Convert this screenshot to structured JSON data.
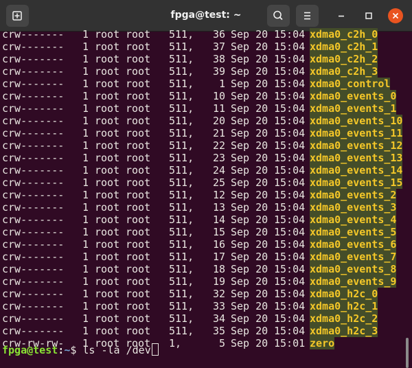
{
  "window": {
    "title": "fpga@test: ~",
    "icons": {
      "new_tab": "new-tab-icon",
      "search": "search-icon",
      "menu": "hamburger-menu-icon",
      "minimize": "minimize-icon",
      "maximize": "maximize-icon",
      "close": "close-icon"
    },
    "colors": {
      "background": "#300a24",
      "titlebar": "#323232",
      "close_button": "#e95420",
      "device_name_fg": "#f4c728",
      "device_name_bg": "#444d29",
      "prompt_user": "#8ae234",
      "prompt_path": "#729fcf"
    }
  },
  "terminal": {
    "listing": [
      {
        "perm": "crw-------",
        "links": "1",
        "owner": "root",
        "group": "root",
        "major": "511,",
        "minor": "36",
        "date": "Sep 20",
        "time": "15:04",
        "name": "xdma0_c2h_0"
      },
      {
        "perm": "crw-------",
        "links": "1",
        "owner": "root",
        "group": "root",
        "major": "511,",
        "minor": "37",
        "date": "Sep 20",
        "time": "15:04",
        "name": "xdma0_c2h_1"
      },
      {
        "perm": "crw-------",
        "links": "1",
        "owner": "root",
        "group": "root",
        "major": "511,",
        "minor": "38",
        "date": "Sep 20",
        "time": "15:04",
        "name": "xdma0_c2h_2"
      },
      {
        "perm": "crw-------",
        "links": "1",
        "owner": "root",
        "group": "root",
        "major": "511,",
        "minor": "39",
        "date": "Sep 20",
        "time": "15:04",
        "name": "xdma0_c2h_3"
      },
      {
        "perm": "crw-------",
        "links": "1",
        "owner": "root",
        "group": "root",
        "major": "511,",
        "minor": "1",
        "date": "Sep 20",
        "time": "15:04",
        "name": "xdma0_control"
      },
      {
        "perm": "crw-------",
        "links": "1",
        "owner": "root",
        "group": "root",
        "major": "511,",
        "minor": "10",
        "date": "Sep 20",
        "time": "15:04",
        "name": "xdma0_events_0"
      },
      {
        "perm": "crw-------",
        "links": "1",
        "owner": "root",
        "group": "root",
        "major": "511,",
        "minor": "11",
        "date": "Sep 20",
        "time": "15:04",
        "name": "xdma0_events_1"
      },
      {
        "perm": "crw-------",
        "links": "1",
        "owner": "root",
        "group": "root",
        "major": "511,",
        "minor": "20",
        "date": "Sep 20",
        "time": "15:04",
        "name": "xdma0_events_10"
      },
      {
        "perm": "crw-------",
        "links": "1",
        "owner": "root",
        "group": "root",
        "major": "511,",
        "minor": "21",
        "date": "Sep 20",
        "time": "15:04",
        "name": "xdma0_events_11"
      },
      {
        "perm": "crw-------",
        "links": "1",
        "owner": "root",
        "group": "root",
        "major": "511,",
        "minor": "22",
        "date": "Sep 20",
        "time": "15:04",
        "name": "xdma0_events_12"
      },
      {
        "perm": "crw-------",
        "links": "1",
        "owner": "root",
        "group": "root",
        "major": "511,",
        "minor": "23",
        "date": "Sep 20",
        "time": "15:04",
        "name": "xdma0_events_13"
      },
      {
        "perm": "crw-------",
        "links": "1",
        "owner": "root",
        "group": "root",
        "major": "511,",
        "minor": "24",
        "date": "Sep 20",
        "time": "15:04",
        "name": "xdma0_events_14"
      },
      {
        "perm": "crw-------",
        "links": "1",
        "owner": "root",
        "group": "root",
        "major": "511,",
        "minor": "25",
        "date": "Sep 20",
        "time": "15:04",
        "name": "xdma0_events_15"
      },
      {
        "perm": "crw-------",
        "links": "1",
        "owner": "root",
        "group": "root",
        "major": "511,",
        "minor": "12",
        "date": "Sep 20",
        "time": "15:04",
        "name": "xdma0_events_2"
      },
      {
        "perm": "crw-------",
        "links": "1",
        "owner": "root",
        "group": "root",
        "major": "511,",
        "minor": "13",
        "date": "Sep 20",
        "time": "15:04",
        "name": "xdma0_events_3"
      },
      {
        "perm": "crw-------",
        "links": "1",
        "owner": "root",
        "group": "root",
        "major": "511,",
        "minor": "14",
        "date": "Sep 20",
        "time": "15:04",
        "name": "xdma0_events_4"
      },
      {
        "perm": "crw-------",
        "links": "1",
        "owner": "root",
        "group": "root",
        "major": "511,",
        "minor": "15",
        "date": "Sep 20",
        "time": "15:04",
        "name": "xdma0_events_5"
      },
      {
        "perm": "crw-------",
        "links": "1",
        "owner": "root",
        "group": "root",
        "major": "511,",
        "minor": "16",
        "date": "Sep 20",
        "time": "15:04",
        "name": "xdma0_events_6"
      },
      {
        "perm": "crw-------",
        "links": "1",
        "owner": "root",
        "group": "root",
        "major": "511,",
        "minor": "17",
        "date": "Sep 20",
        "time": "15:04",
        "name": "xdma0_events_7"
      },
      {
        "perm": "crw-------",
        "links": "1",
        "owner": "root",
        "group": "root",
        "major": "511,",
        "minor": "18",
        "date": "Sep 20",
        "time": "15:04",
        "name": "xdma0_events_8"
      },
      {
        "perm": "crw-------",
        "links": "1",
        "owner": "root",
        "group": "root",
        "major": "511,",
        "minor": "19",
        "date": "Sep 20",
        "time": "15:04",
        "name": "xdma0_events_9"
      },
      {
        "perm": "crw-------",
        "links": "1",
        "owner": "root",
        "group": "root",
        "major": "511,",
        "minor": "32",
        "date": "Sep 20",
        "time": "15:04",
        "name": "xdma0_h2c_0"
      },
      {
        "perm": "crw-------",
        "links": "1",
        "owner": "root",
        "group": "root",
        "major": "511,",
        "minor": "33",
        "date": "Sep 20",
        "time": "15:04",
        "name": "xdma0_h2c_1"
      },
      {
        "perm": "crw-------",
        "links": "1",
        "owner": "root",
        "group": "root",
        "major": "511,",
        "minor": "34",
        "date": "Sep 20",
        "time": "15:04",
        "name": "xdma0_h2c_2"
      },
      {
        "perm": "crw-------",
        "links": "1",
        "owner": "root",
        "group": "root",
        "major": "511,",
        "minor": "35",
        "date": "Sep 20",
        "time": "15:04",
        "name": "xdma0_h2c_3"
      },
      {
        "perm": "crw-rw-rw-",
        "links": "1",
        "owner": "root",
        "group": "root",
        "major": "1,",
        "minor": "5",
        "date": "Sep 20",
        "time": "15:01",
        "name": "zero"
      }
    ],
    "prompt": {
      "user_host": "fpga@test",
      "separator": ":",
      "path": "~",
      "symbol": "$ ",
      "command": "ls -la /dev"
    }
  }
}
